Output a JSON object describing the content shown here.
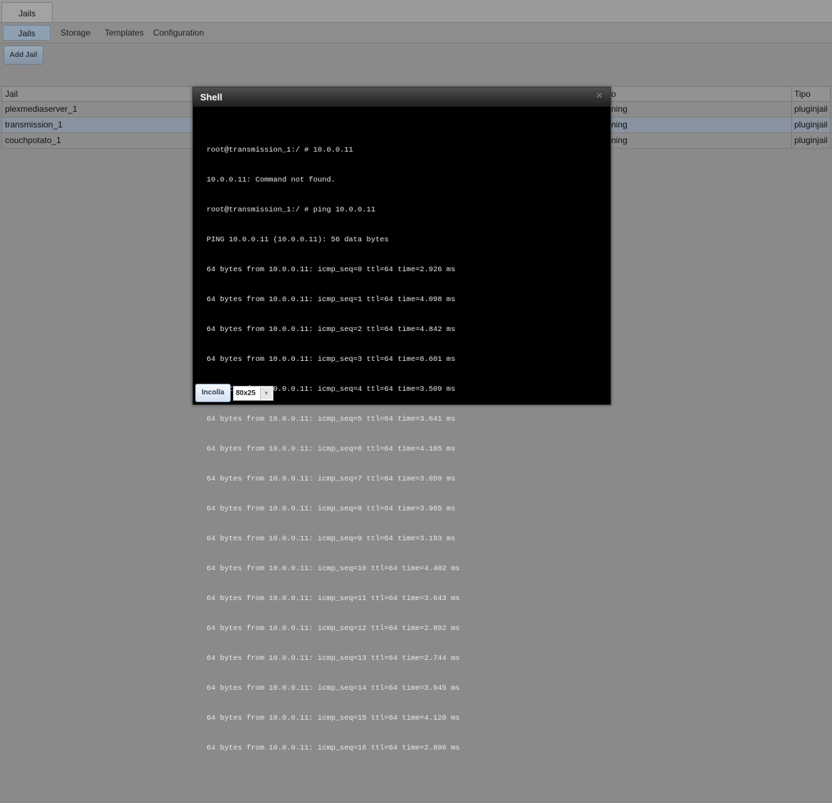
{
  "tabs": {
    "main": "Jails"
  },
  "subnav": {
    "items": [
      "Jails",
      "Storage",
      "Templates",
      "Configuration"
    ],
    "active": "Jails"
  },
  "toolbar": {
    "add_label": "Add Jail"
  },
  "grid": {
    "headers": {
      "jail": "Jail",
      "stato": "o",
      "tipo": "Tipo"
    },
    "rows": [
      {
        "jail": "plexmediaserver_1",
        "stato": "ning",
        "tipo": "pluginjail"
      },
      {
        "jail": "transmission_1",
        "stato": "ning",
        "tipo": "pluginjail"
      },
      {
        "jail": "couchpotato_1",
        "stato": "ning",
        "tipo": "pluginjail"
      }
    ]
  },
  "shell": {
    "title": "Shell",
    "close_icon": "close-icon",
    "lines": [
      "root@transmission_1:/ # 10.0.0.11",
      "10.0.0.11: Command not found.",
      "root@transmission_1:/ # ping 10.0.0.11",
      "PING 10.0.0.11 (10.0.0.11): 56 data bytes",
      "64 bytes from 10.0.0.11: icmp_seq=0 ttl=64 time=2.926 ms",
      "64 bytes from 10.0.0.11: icmp_seq=1 ttl=64 time=4.098 ms",
      "64 bytes from 10.0.0.11: icmp_seq=2 ttl=64 time=4.842 ms",
      "64 bytes from 10.0.0.11: icmp_seq=3 ttl=64 time=8.601 ms",
      "64 bytes from 10.0.0.11: icmp_seq=4 ttl=64 time=3.509 ms",
      "64 bytes from 10.0.0.11: icmp_seq=5 ttl=64 time=3.641 ms",
      "64 bytes from 10.0.0.11: icmp_seq=6 ttl=64 time=4.105 ms",
      "64 bytes from 10.0.0.11: icmp_seq=7 ttl=64 time=3.059 ms",
      "64 bytes from 10.0.0.11: icmp_seq=8 ttl=64 time=3.965 ms",
      "64 bytes from 10.0.0.11: icmp_seq=9 ttl=64 time=3.193 ms",
      "64 bytes from 10.0.0.11: icmp_seq=10 ttl=64 time=4.402 ms",
      "64 bytes from 10.0.0.11: icmp_seq=11 ttl=64 time=3.643 ms",
      "64 bytes from 10.0.0.11: icmp_seq=12 ttl=64 time=2.892 ms",
      "64 bytes from 10.0.0.11: icmp_seq=13 ttl=64 time=2.744 ms",
      "64 bytes from 10.0.0.11: icmp_seq=14 ttl=64 time=3.945 ms",
      "64 bytes from 10.0.0.11: icmp_seq=15 ttl=64 time=4.120 ms",
      "64 bytes from 10.0.0.11: icmp_seq=16 ttl=64 time=2.896 ms"
    ],
    "paste_label": "Incolla",
    "size_value": "80x25"
  }
}
